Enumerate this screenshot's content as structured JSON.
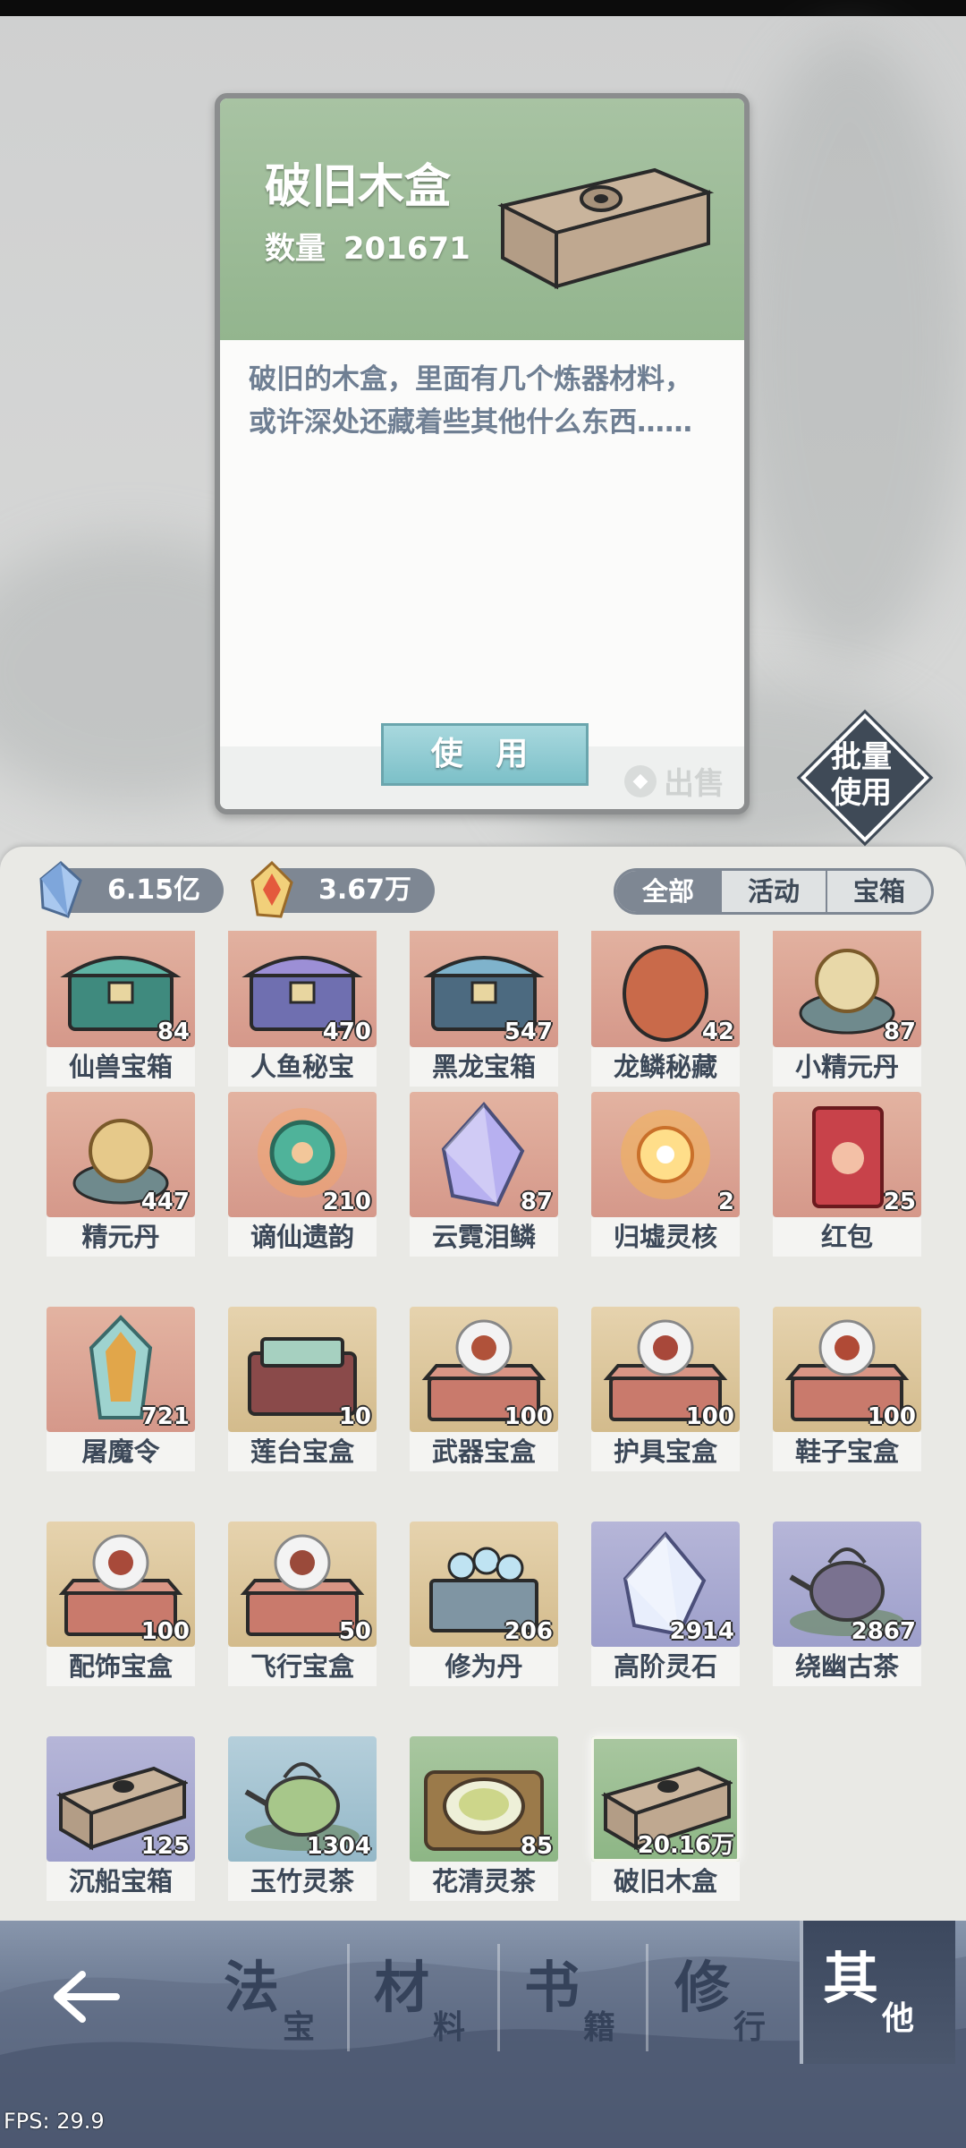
{
  "detail": {
    "title": "破旧木盒",
    "quantity_label": "数量",
    "quantity_value": "201671",
    "description": "破旧的木盒，里面有几个炼器材料，或许深处还藏着些其他什么东西……",
    "use_label": "使 用",
    "sell_label": "出售"
  },
  "batch_use": {
    "line1": "批量",
    "line2": "使用"
  },
  "currencies": [
    {
      "icon": "blue-crystal-icon",
      "value": "6.15亿"
    },
    {
      "icon": "gold-crystal-icon",
      "value": "3.67万"
    }
  ],
  "filter_tabs": [
    {
      "label": "全部",
      "active": true
    },
    {
      "label": "活动",
      "active": false
    },
    {
      "label": "宝箱",
      "active": false
    }
  ],
  "items": [
    {
      "name": "仙兽宝箱",
      "count": "84",
      "tile": "red",
      "icon": "jade-chest-icon"
    },
    {
      "name": "人鱼秘宝",
      "count": "470",
      "tile": "red",
      "icon": "purple-chest-icon"
    },
    {
      "name": "黑龙宝箱",
      "count": "547",
      "tile": "red",
      "icon": "dragon-chest-icon"
    },
    {
      "name": "龙鳞秘藏",
      "count": "42",
      "tile": "red",
      "icon": "scale-urn-icon"
    },
    {
      "name": "小精元丹",
      "count": "87",
      "tile": "red",
      "icon": "small-pill-icon"
    },
    {
      "name": "精元丹",
      "count": "447",
      "tile": "red",
      "icon": "essence-pill-icon"
    },
    {
      "name": "谪仙遗韵",
      "count": "210",
      "tile": "red",
      "icon": "jade-pendant-icon"
    },
    {
      "name": "云霓泪鳞",
      "count": "87",
      "tile": "red",
      "icon": "crystal-drop-icon"
    },
    {
      "name": "归墟灵核",
      "count": "2",
      "tile": "red",
      "icon": "spirit-core-icon"
    },
    {
      "name": "红包",
      "count": "25",
      "tile": "red",
      "icon": "red-envelope-icon"
    },
    {
      "name": "屠魔令",
      "count": "721",
      "tile": "red",
      "icon": "demon-token-icon"
    },
    {
      "name": "莲台宝盒",
      "count": "10",
      "tile": "gold",
      "icon": "lotus-box-icon"
    },
    {
      "name": "武器宝盒",
      "count": "100",
      "tile": "gold",
      "icon": "weapon-box-icon"
    },
    {
      "name": "护具宝盒",
      "count": "100",
      "tile": "gold",
      "icon": "armor-box-icon"
    },
    {
      "name": "鞋子宝盒",
      "count": "100",
      "tile": "gold",
      "icon": "shoes-box-icon"
    },
    {
      "name": "配饰宝盒",
      "count": "100",
      "tile": "gold",
      "icon": "accessory-box-icon"
    },
    {
      "name": "飞行宝盒",
      "count": "50",
      "tile": "gold",
      "icon": "flying-box-icon"
    },
    {
      "name": "修为丹",
      "count": "206",
      "tile": "gold",
      "icon": "cultivation-pill-icon"
    },
    {
      "name": "高阶灵石",
      "count": "2914",
      "tile": "purple",
      "icon": "spirit-stone-icon"
    },
    {
      "name": "绕幽古茶",
      "count": "2867",
      "tile": "purple",
      "icon": "teapot-icon"
    },
    {
      "name": "沉船宝箱",
      "count": "125",
      "tile": "purple",
      "icon": "wooden-chest-icon"
    },
    {
      "name": "玉竹灵茶",
      "count": "1304",
      "tile": "blue",
      "icon": "green-teapot-icon"
    },
    {
      "name": "花清灵茶",
      "count": "85",
      "tile": "green",
      "icon": "tea-cup-icon"
    },
    {
      "name": "破旧木盒",
      "count": "20.16万",
      "tile": "green",
      "icon": "old-wooden-box-icon",
      "selected": true
    }
  ],
  "nav": [
    {
      "big": "法",
      "small": "宝",
      "active": false
    },
    {
      "big": "材",
      "small": "料",
      "active": false
    },
    {
      "big": "书",
      "small": "籍",
      "active": false
    },
    {
      "big": "修",
      "small": "行",
      "active": false
    },
    {
      "big": "其",
      "small": "他",
      "active": true
    }
  ],
  "fps": "FPS: 29.9"
}
